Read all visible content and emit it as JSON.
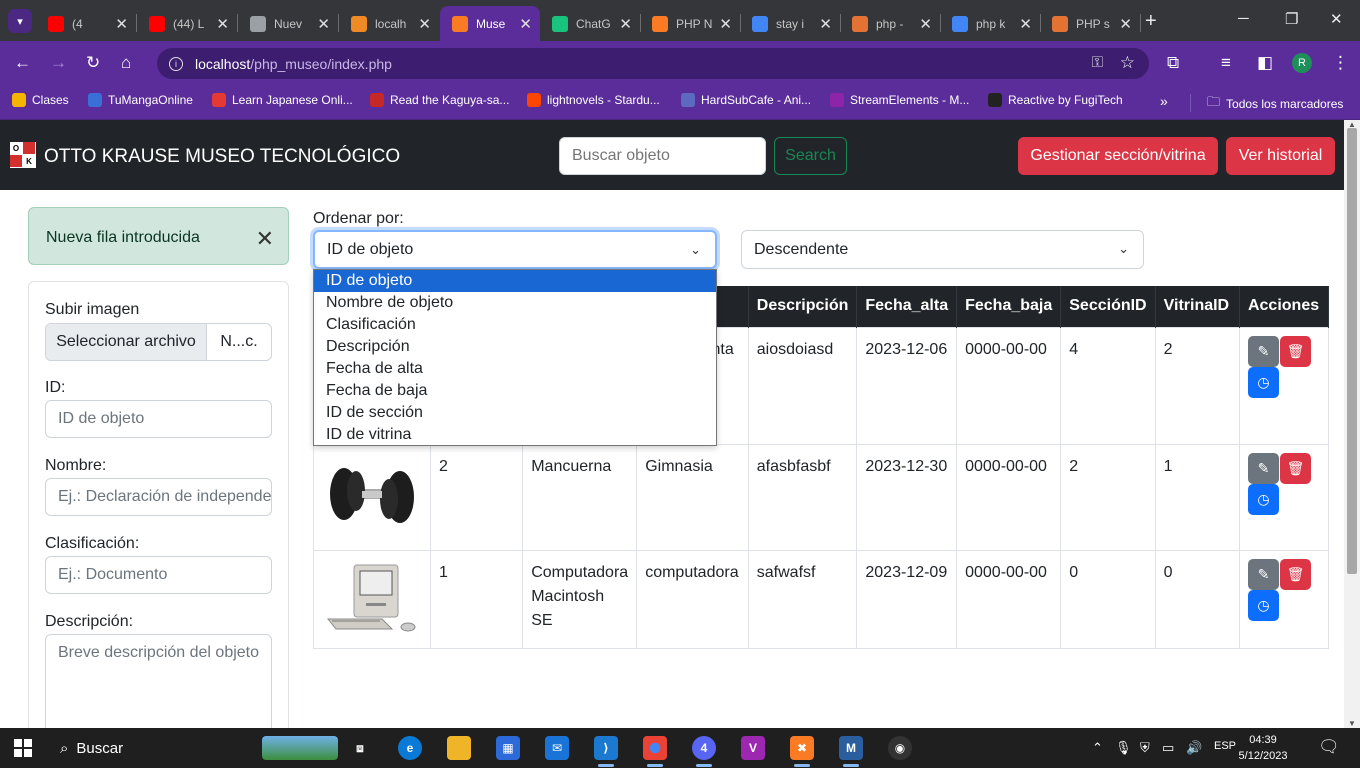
{
  "browser": {
    "tabs": [
      {
        "title": "(4",
        "icon": "youtube-icon",
        "color": "#ff0000"
      },
      {
        "title": "(44) L",
        "icon": "youtube-icon",
        "color": "#ff0000"
      },
      {
        "title": "Nuev",
        "icon": "chrome-icon",
        "color": "#9aa0a6"
      },
      {
        "title": "localh",
        "icon": "phpmyadmin-icon",
        "color": "#f08a24"
      },
      {
        "title": "Muse",
        "icon": "xampp-icon",
        "color": "#fb7a24"
      },
      {
        "title": "ChatG",
        "icon": "chatgpt-icon",
        "color": "#19c37d"
      },
      {
        "title": "PHP N",
        "icon": "xampp-icon",
        "color": "#fb7a24"
      },
      {
        "title": "stay i",
        "icon": "google-icon",
        "color": "#4285f4"
      },
      {
        "title": "php -",
        "icon": "php-docs-icon",
        "color": "#e37233"
      },
      {
        "title": "php k",
        "icon": "google-icon",
        "color": "#4285f4"
      },
      {
        "title": "PHP s",
        "icon": "php-docs-icon",
        "color": "#e37233"
      }
    ],
    "url_host": "localhost",
    "url_path": "/php_museo/index.php",
    "profile_initial": "R",
    "bookmarks": [
      {
        "label": "Clases",
        "icon": "classroom-icon",
        "color": "#f4b400"
      },
      {
        "label": "TuMangaOnline",
        "icon": "tmo-icon",
        "color": "#3a6fd8"
      },
      {
        "label": "Learn Japanese Onli...",
        "icon": "japanese-icon",
        "color": "#e53935"
      },
      {
        "label": "Read the Kaguya-sa...",
        "icon": "kaguya-icon",
        "color": "#c62828"
      },
      {
        "label": "lightnovels - Stardu...",
        "icon": "reddit-icon",
        "color": "#ff4500"
      },
      {
        "label": "HardSubCafe - Ani...",
        "icon": "hardsub-icon",
        "color": "#5c6bc0"
      },
      {
        "label": "StreamElements - M...",
        "icon": "streamelements-icon",
        "color": "#8e24aa"
      },
      {
        "label": "Reactive by FugiTech",
        "icon": "reactive-icon",
        "color": "#222222"
      }
    ],
    "all_bookmarks": "Todos los marcadores"
  },
  "navbar": {
    "logo_letters": [
      "O",
      "K"
    ],
    "brand": "OTTO KRAUSE MUSEO TECNOLÓGICO",
    "search_placeholder": "Buscar objeto",
    "search_button": "Search",
    "manage_button": "Gestionar sección/vitrina",
    "history_button": "Ver historial"
  },
  "alert": {
    "message": "Nueva fila introducida",
    "close": "✕"
  },
  "form": {
    "upload_label": "Subir imagen",
    "file_button": "Seleccionar archivo",
    "file_name": "N...c.",
    "id_label": "ID:",
    "id_placeholder": "ID de objeto",
    "name_label": "Nombre:",
    "name_placeholder": "Ej.: Declaración de independencia",
    "class_label": "Clasificación:",
    "class_placeholder": "Ej.: Documento",
    "desc_label": "Descripción:",
    "desc_placeholder": "Breve descripción del objeto"
  },
  "sort": {
    "label": "Ordenar por:",
    "selected": "ID de objeto",
    "options": [
      "ID de objeto",
      "Nombre de objeto",
      "Clasificación",
      "Descripción",
      "Fecha de alta",
      "Fecha de baja",
      "ID de sección",
      "ID de vitrina"
    ],
    "direction": "Descendente"
  },
  "table": {
    "headers": [
      "",
      "",
      "",
      "Clasificación",
      "Descripción",
      "Fecha_alta",
      "Fecha_baja",
      "SecciónID",
      "VitrinaID",
      "Acciones"
    ],
    "header_visible_clasificacion": "cación",
    "rows": [
      {
        "image": "tool-image",
        "id": "",
        "name": "",
        "class": "ienta",
        "desc": "aiosdoiasd",
        "alta": "2023-12-06",
        "baja": "0000-00-00",
        "seccion": "4",
        "vitrina": "2"
      },
      {
        "image": "dumbbell-image",
        "id": "2",
        "name": "Mancuerna",
        "class": "Gimnasia",
        "desc": "afasbfasbf",
        "alta": "2023-12-30",
        "baja": "0000-00-00",
        "seccion": "2",
        "vitrina": "1"
      },
      {
        "image": "macintosh-image",
        "id": "1",
        "name": "Computadora Macintosh SE",
        "class": "computadora",
        "desc": "safwafsf",
        "alta": "2023-12-09",
        "baja": "0000-00-00",
        "seccion": "0",
        "vitrina": "0"
      }
    ]
  },
  "taskbar": {
    "search": "Buscar",
    "lang": "ESP",
    "time": "04:39",
    "date": "5/12/2023"
  },
  "colors": {
    "accent": "#5b2d9a",
    "danger": "#dc3545",
    "success": "#198754",
    "primary": "#0d6efd"
  }
}
